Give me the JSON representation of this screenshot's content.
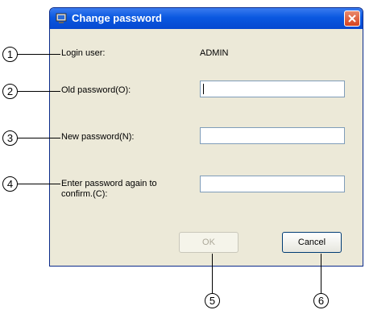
{
  "dialog": {
    "title": "Change password",
    "login_user_label": "Login user:",
    "login_user_value": "ADMIN",
    "old_password_label": "Old password(O):",
    "new_password_label": "New password(N):",
    "confirm_label_line1": "Enter password again to",
    "confirm_label_line2": "confirm.(C):",
    "ok_label": "OK",
    "cancel_label": "Cancel"
  },
  "callouts": [
    "1",
    "2",
    "3",
    "4",
    "5",
    "6"
  ],
  "colors": {
    "title_bar": "#0a58e0",
    "dialog_bg": "#ece9d8",
    "field_border": "#7f9db9"
  },
  "icons": [
    "computer-icon",
    "close-icon"
  ]
}
